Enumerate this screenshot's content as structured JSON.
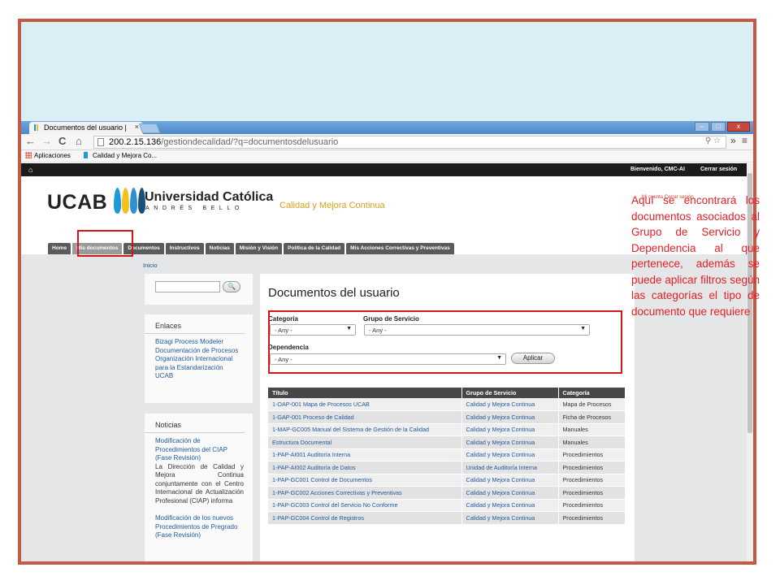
{
  "browser": {
    "tab_title": "Documentos del usuario |",
    "tab_close": "×",
    "url_host": "200.2.15.136",
    "url_path": "/gestiondecalidad/?q=documentosdelusuario",
    "bookmarks": [
      "Aplicaciones",
      "Calidad y Mejora Co..."
    ],
    "nav_icons": {
      "back": "←",
      "forward": "→",
      "reload": "C",
      "home": "⌂",
      "more": "»",
      "menu": "≡"
    }
  },
  "site": {
    "topbar": {
      "welcome": "Bienvenido, CMC-AI",
      "logout": "Cerrar sesión"
    },
    "logo": {
      "ucab": "UCAB",
      "university": "Universidad Católica",
      "andres_bello": "ANDRÉS BELLO",
      "drop_colors": [
        "#1f9ad6",
        "#f6c21a",
        "#2f8fd0",
        "#1b4e7a"
      ]
    },
    "section_title": "Calidad y Mejora Continua",
    "user_links": "Mi cuenta   Cerrar sesión",
    "nav_tabs": [
      "Home",
      "Mis documentos",
      "Documentos",
      "Instructivos",
      "Noticias",
      "Misión y Visión",
      "Política de la Calidad",
      "Mis Acciones Correctivas y Preventivas"
    ],
    "breadcrumb": "Inicio",
    "search_button": "🔍"
  },
  "sidebar": {
    "enlaces_title": "Enlaces",
    "enlaces": [
      "Bizagi Process Modeler",
      "Documentación de Procesos",
      "Organización Internacional para la Estandarización",
      "UCAB"
    ],
    "noticias_title": "Noticias",
    "noticias": [
      {
        "title": "Modificación de Procedimientos del CIAP (Fase Revisión)",
        "desc": "La Dirección de Calidad y Mejora Continua conjuntamente con el Centro Internacional de Actualización Profesional (CIAP) informa"
      },
      {
        "title": "Modificación de los nuevos Procedimientos de Pregrado (Fase Revisión)"
      }
    ]
  },
  "main": {
    "title": "Documentos del usuario",
    "filters": {
      "categoria_label": "Categoría",
      "grupo_label": "Grupo de Servicio",
      "dependencia_label": "Dependencia",
      "any": "- Any -",
      "apply": "Aplicar"
    },
    "table": {
      "headers": [
        "Título",
        "Grupo de Servicio",
        "Categoría"
      ],
      "rows": [
        [
          "1-OAP-001 Mapa de Procesos UCAB",
          "Calidad y Mejora Continua",
          "Mapa de Procesos"
        ],
        [
          "1-GAP-001 Proceso de Calidad",
          "Calidad y Mejora Continua",
          "Ficha de Procesos"
        ],
        [
          "1-MAP-GC005 Manual del Sistema de Gestión de la Calidad",
          "Calidad y Mejora Continua",
          "Manuales"
        ],
        [
          "Estructura Documental",
          "Calidad y Mejora Continua",
          "Manuales"
        ],
        [
          "1-PAP-AI001 Auditoría Interna",
          "Calidad y Mejora Continua",
          "Procedimientos"
        ],
        [
          "1-PAP-AI002 Auditoría de Datos",
          "Unidad de Auditoría Interna",
          "Procedimientos"
        ],
        [
          "1-PAP-GC001 Control de Documentos",
          "Calidad y Mejora Continua",
          "Procedimientos"
        ],
        [
          "1-PAP-GC002 Acciones Correctivas y Preventivas",
          "Calidad y Mejora Continua",
          "Procedimientos"
        ],
        [
          "1-PAP-GC003 Control del Servicio No Conforme",
          "Calidad y Mejora Continua",
          "Procedimientos"
        ],
        [
          "1-PAP-GC004 Control de Registros",
          "Calidad y Mejora Continua",
          "Procedimientos"
        ]
      ]
    }
  },
  "annotation": "Aquí se encontrará los documentos asociados al Grupo de Servicio y Dependencia al que pertenece, además se puede aplicar filtros según las categorías el tipo de documento que requiere",
  "colors": {
    "frame_border": "#c55a44",
    "slide_bg": "#dbeef3",
    "highlight": "#d0181c",
    "annotation_text": "#e41f26"
  }
}
